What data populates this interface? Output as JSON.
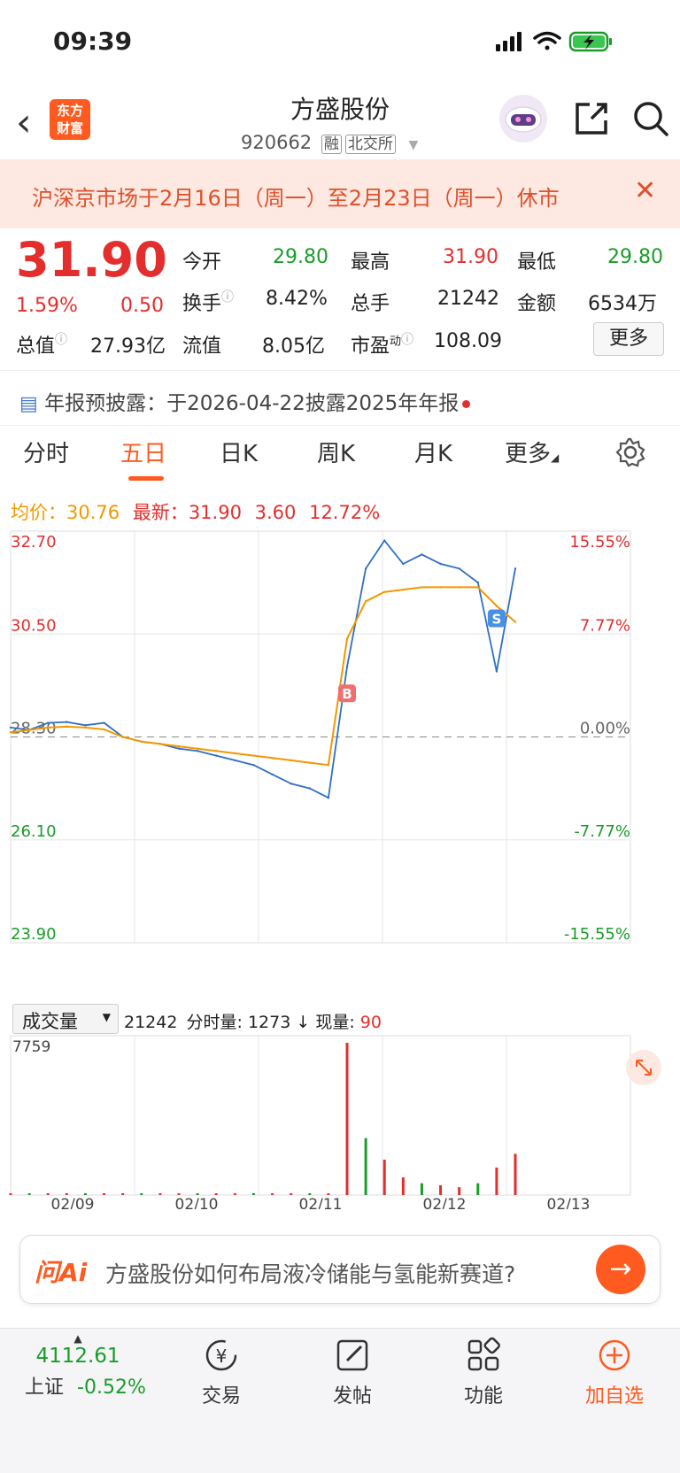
{
  "status_bar": {
    "time": "09:39"
  },
  "header": {
    "logo_text": "东方财富",
    "stock_name": "方盛股份",
    "stock_code": "920662",
    "tag_margin": "融",
    "tag_exchange": "北交所"
  },
  "banner": {
    "text": "沪深京市场于2月16日（周一）至2月23日（周一）休市"
  },
  "quote": {
    "price": "31.90",
    "change_pct": "1.59%",
    "change": "0.50",
    "open_label": "今开",
    "open": "29.80",
    "high_label": "最高",
    "high": "31.90",
    "low_label": "最低",
    "low": "29.80",
    "turnover_label": "换手",
    "turnover": "8.42%",
    "volume_label": "总手",
    "volume": "21242",
    "amount_label": "金额",
    "amount": "6534万",
    "mktcap_label": "总值",
    "mktcap": "27.93亿",
    "float_label": "流值",
    "float_cap": "8.05亿",
    "pe_label": "市盈",
    "pe_sup": "动",
    "pe": "108.09",
    "more_button": "更多"
  },
  "notice": {
    "label": "年报预披露：",
    "text": "于2026-04-22披露2025年年报"
  },
  "tabs": [
    "分时",
    "五日",
    "日K",
    "周K",
    "月K",
    "更多"
  ],
  "active_tab": 1,
  "chart_info": {
    "avg_label": "均价：",
    "avg": "30.76",
    "last_label": "最新：",
    "last": "31.90",
    "change": "3.60",
    "change_pct": "12.72%"
  },
  "chart_data": {
    "type": "line",
    "price_axis": [
      "32.70",
      "30.50",
      "28.30",
      "26.10",
      "23.90"
    ],
    "pct_axis": [
      "15.55%",
      "7.77%",
      "0.00%",
      "-7.77%",
      "-15.55%"
    ],
    "ylim": [
      23.9,
      32.7
    ],
    "x": [
      "02/09",
      "02/10",
      "02/11",
      "02/12",
      "02/13"
    ],
    "series": [
      {
        "values": [
          28.5,
          28.45,
          28.6,
          28.62,
          28.55,
          28.6,
          28.3,
          28.2,
          28.15,
          28.05,
          28.0,
          27.9,
          27.8,
          27.7,
          27.5,
          27.3,
          27.2,
          27.0,
          29.8,
          31.9,
          32.5,
          32.0,
          32.2,
          32.0,
          31.9,
          31.6,
          29.7,
          31.9
        ]
      },
      {
        "values": [
          28.4,
          28.45,
          28.5,
          28.52,
          28.5,
          28.46,
          28.3,
          28.2,
          28.15,
          28.1,
          28.05,
          28.0,
          27.95,
          27.9,
          27.85,
          27.8,
          27.75,
          27.7,
          30.4,
          31.2,
          31.4,
          31.45,
          31.5,
          31.5,
          31.5,
          31.5,
          31.1,
          30.76
        ]
      }
    ],
    "markers": [
      {
        "label": "B"
      },
      {
        "label": "S"
      }
    ],
    "volume_max_label": "7759",
    "volume": [
      5,
      3,
      2,
      6,
      4,
      2,
      3,
      5,
      4,
      3,
      2,
      4,
      3,
      5,
      3,
      4,
      2,
      3,
      7759,
      2900,
      1800,
      900,
      600,
      500,
      400,
      600,
      1400,
      2100
    ]
  },
  "volume_header": {
    "selector": "成交量",
    "total": "21242",
    "minute_label": "分时量:",
    "minute": "1273",
    "now_label": "现量:",
    "now": "90"
  },
  "ai_box": {
    "brand": "问Ai",
    "prompt": "方盛股份如何布局液冷储能与氢能新赛道?"
  },
  "bottom_nav": {
    "index_value": "4112.61",
    "index_name": "上证",
    "index_change": "-0.52%",
    "trade": "交易",
    "post": "发帖",
    "functions": "功能",
    "add_watch": "加自选"
  },
  "colors": {
    "accent": "#ff5a1f",
    "up": "#e42e2e",
    "down": "#1a9c29",
    "avg_line": "#f39800",
    "price_line": "#2f6fc4"
  }
}
